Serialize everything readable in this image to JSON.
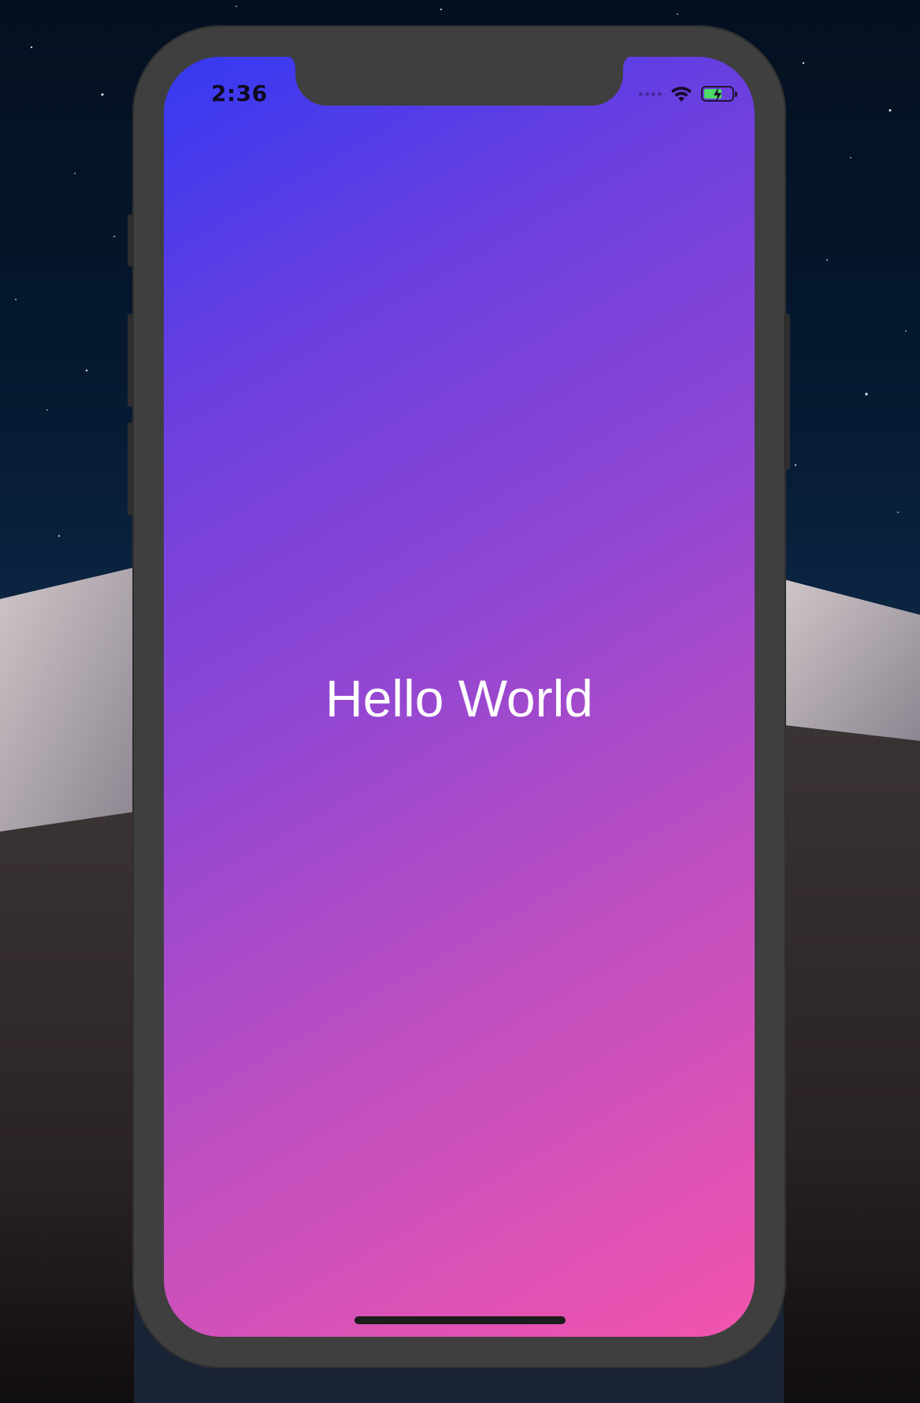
{
  "status_bar": {
    "time": "2:36",
    "icons": [
      "signal-dots-icon",
      "wifi-icon",
      "battery-charging-icon"
    ]
  },
  "app": {
    "greeting": "Hello World",
    "background_gradient": [
      "#3539f2",
      "#9046d3",
      "#f254ad"
    ]
  },
  "device": {
    "frame_color": "#3f3f3f"
  }
}
